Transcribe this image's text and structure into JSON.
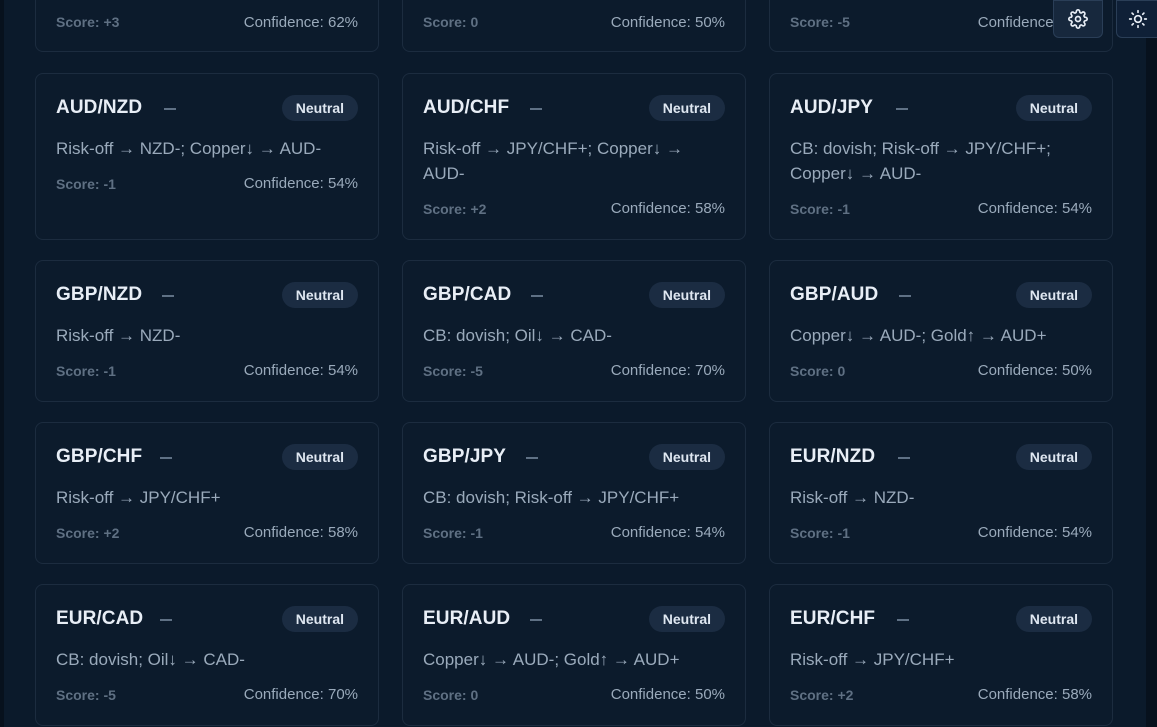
{
  "top_row": [
    {
      "score": "Score: +3",
      "confidence": "Confidence: 62%"
    },
    {
      "score": "Score: 0",
      "confidence": "Confidence: 50%"
    },
    {
      "score": "Score: -5",
      "confidence": "Confidence: 70%"
    }
  ],
  "cards": [
    {
      "pair": "AUD/NZD",
      "bias": "Neutral",
      "drivers": "Risk-off → NZD-; Copper↓ → AUD-",
      "score": "Score: -1",
      "confidence": "Confidence: 54%"
    },
    {
      "pair": "AUD/CHF",
      "bias": "Neutral",
      "drivers": "Risk-off → JPY/CHF+; Copper↓ → AUD-",
      "score": "Score: +2",
      "confidence": "Confidence: 58%"
    },
    {
      "pair": "AUD/JPY",
      "bias": "Neutral",
      "drivers": "CB: dovish; Risk-off → JPY/CHF+; Copper↓ → AUD-",
      "score": "Score: -1",
      "confidence": "Confidence: 54%"
    },
    {
      "pair": "GBP/NZD",
      "bias": "Neutral",
      "drivers": "Risk-off → NZD-",
      "score": "Score: -1",
      "confidence": "Confidence: 54%"
    },
    {
      "pair": "GBP/CAD",
      "bias": "Neutral",
      "drivers": "CB: dovish; Oil↓ → CAD-",
      "score": "Score: -5",
      "confidence": "Confidence: 70%"
    },
    {
      "pair": "GBP/AUD",
      "bias": "Neutral",
      "drivers": "Copper↓ → AUD-; Gold↑ → AUD+",
      "score": "Score: 0",
      "confidence": "Confidence: 50%"
    },
    {
      "pair": "GBP/CHF",
      "bias": "Neutral",
      "drivers": "Risk-off → JPY/CHF+",
      "score": "Score: +2",
      "confidence": "Confidence: 58%"
    },
    {
      "pair": "GBP/JPY",
      "bias": "Neutral",
      "drivers": "CB: dovish; Risk-off → JPY/CHF+",
      "score": "Score: -1",
      "confidence": "Confidence: 54%"
    },
    {
      "pair": "EUR/NZD",
      "bias": "Neutral",
      "drivers": "Risk-off → NZD-",
      "score": "Score: -1",
      "confidence": "Confidence: 54%"
    },
    {
      "pair": "EUR/CAD",
      "bias": "Neutral",
      "drivers": "CB: dovish; Oil↓ → CAD-",
      "score": "Score: -5",
      "confidence": "Confidence: 70%"
    },
    {
      "pair": "EUR/AUD",
      "bias": "Neutral",
      "drivers": "Copper↓ → AUD-; Gold↑ → AUD+",
      "score": "Score: 0",
      "confidence": "Confidence: 50%"
    },
    {
      "pair": "EUR/CHF",
      "bias": "Neutral",
      "drivers": "Risk-off → JPY/CHF+",
      "score": "Score: +2",
      "confidence": "Confidence: 58%"
    }
  ],
  "toolbar": {
    "settings_icon": "gear-icon",
    "theme_icon": "sun-icon"
  },
  "colors": {
    "background": "#0b1a2b",
    "card": "#0c1b2c",
    "card_border": "#1c2c3f",
    "badge_bg": "#1b2c42",
    "text_primary": "#e8eef6",
    "text_secondary": "#9aaabb",
    "text_muted": "#5f7083"
  }
}
